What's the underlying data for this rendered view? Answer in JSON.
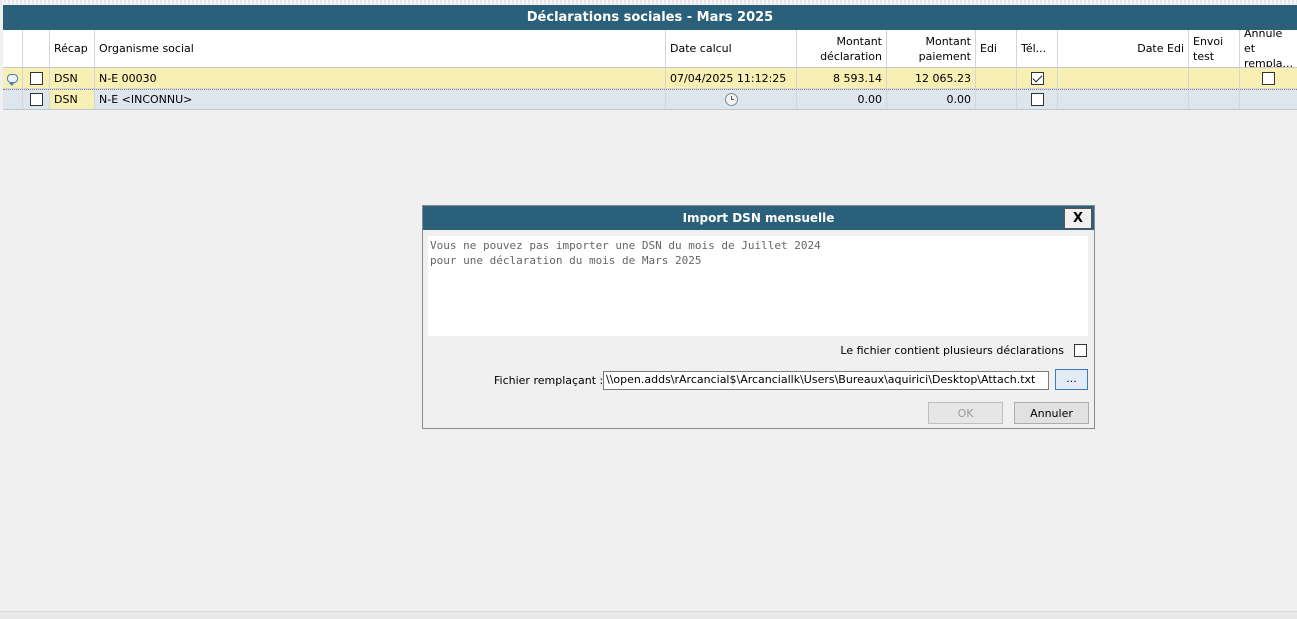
{
  "window": {
    "title": "Déclarations sociales - Mars 2025"
  },
  "grid": {
    "headers": {
      "recap": "Récap",
      "organisme": "Organisme social",
      "date_calcul": "Date calcul",
      "montant_declaration": "Montant déclaration",
      "montant_paiement": "Montant paiement",
      "edi": "Edi",
      "tel": "Tél...",
      "date_edi": "Date Edi",
      "envoi_test": "Envoi test",
      "annule": "Annule et rempla..."
    },
    "rows": [
      {
        "recap": "DSN",
        "organisme": "N-E  00030",
        "date_calcul": "07/04/2025 11:12:25",
        "montant_declaration": "8 593.14",
        "montant_paiement": "12 065.23",
        "has_comment": true,
        "selected": false,
        "teletransmis": true,
        "annule": false
      },
      {
        "recap": "DSN",
        "organisme": "N-E <INCONNU>",
        "date_calcul": "",
        "montant_declaration": "0.00",
        "montant_paiement": "0.00",
        "has_comment": false,
        "selected": false,
        "teletransmis": false,
        "annule": false
      }
    ]
  },
  "icons": {
    "comment": "comment-icon",
    "clock": "clock-icon"
  },
  "dialog": {
    "title": "Import DSN mensuelle",
    "close_label": "X",
    "message": "Vous ne pouvez pas importer une DSN du mois de Juillet 2024\npour une déclaration du mois de Mars 2025",
    "multi_label": "Le fichier contient plusieurs déclarations",
    "multi_checked": false,
    "file_label": "Fichier remplaçant :",
    "file_value": "\\\\open.adds\\rArcancial$\\Arcanciallk\\Users\\Bureaux\\aquirici\\Desktop\\Attach.txt",
    "browse_label": "...",
    "ok_label": "OK",
    "cancel_label": "Annuler"
  },
  "colors": {
    "title_bar": "#2a6079",
    "row_highlight": "#f7efb4",
    "row_selected": "#dde6ed"
  }
}
